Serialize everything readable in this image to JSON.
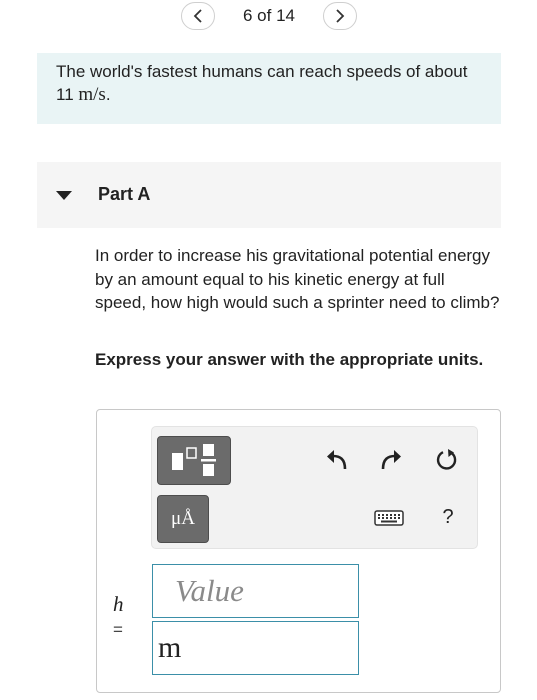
{
  "pager": {
    "position": "6 of 14",
    "prev_icon": "chevron-left-icon",
    "next_icon": "chevron-right-icon"
  },
  "intro": {
    "text_before": "The world's fastest humans can reach speeds of about 11 ",
    "unit": "m/s",
    "text_after": "."
  },
  "part": {
    "title": "Part A",
    "expanded": true
  },
  "question": "In order to increase his gravitational potential energy by an amount equal to his kinetic energy at full speed, how high would such a sprinter need to climb?",
  "instruction": "Express your answer with the appropriate units.",
  "toolbar": {
    "units_label": "μÅ",
    "help_label": "?",
    "icons": [
      "templates-icon",
      "units-icon",
      "undo-icon",
      "redo-icon",
      "reset-icon",
      "keyboard-icon",
      "help-icon"
    ]
  },
  "answer": {
    "variable": "h",
    "equals": "=",
    "value_placeholder": "Value",
    "value": "",
    "unit_value": "m"
  },
  "colors": {
    "intro_bg": "#e9f4f5",
    "input_border": "#3b8fa8",
    "button_bg": "#6b6b6b"
  }
}
